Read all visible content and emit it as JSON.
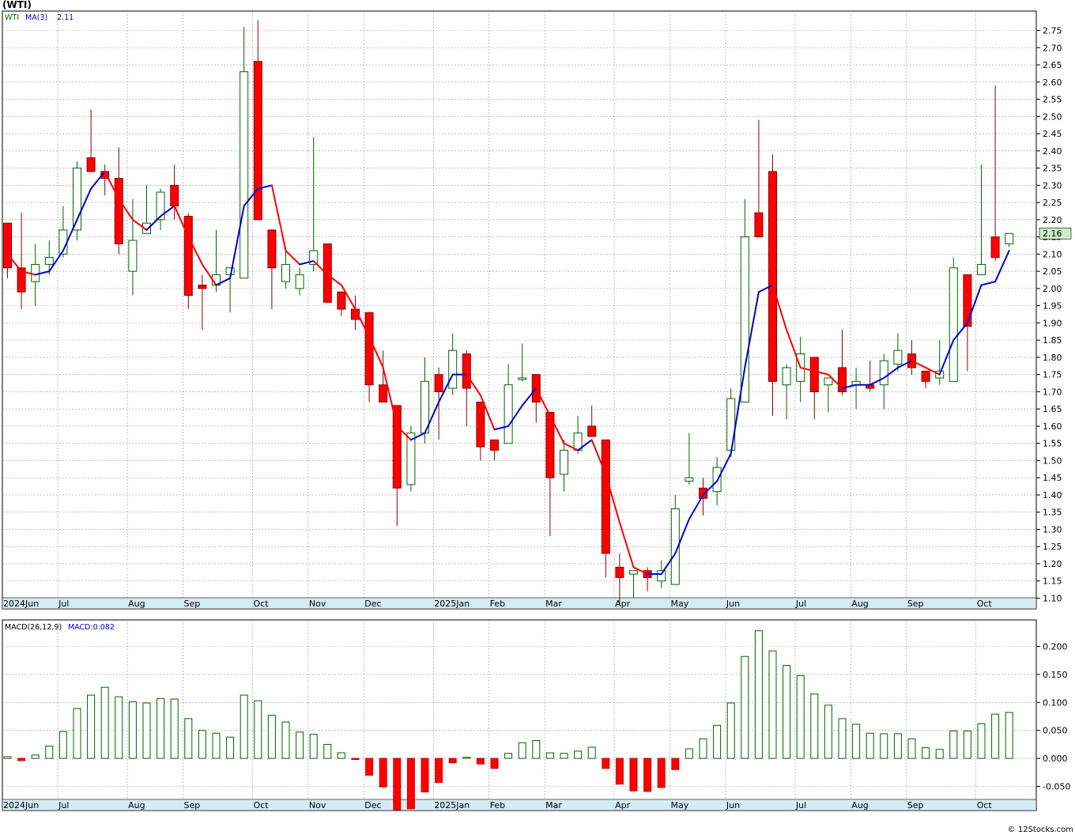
{
  "title": "(WTI)",
  "watermark": "© 12Stocks.com",
  "colors": {
    "up": "#ffffff",
    "upStroke": "#006400",
    "down": "#ff0000",
    "downStroke": "#8b0000",
    "maUp": "#0000cc",
    "maDown": "#ff0000",
    "grid": "#9a9a9a",
    "axisBg": "#d4ecf4",
    "histStroke": "#006400",
    "histDown": "#ff0000",
    "lastBg": "#c8f0c8"
  },
  "chart_data": [
    {
      "type": "candlestick",
      "legend": {
        "symbol": "WTI",
        "ma_label": "MA(3)",
        "ma_value": "2.11"
      },
      "last_price": "2.16",
      "y_ticks": [
        "1.10",
        "1.15",
        "1.20",
        "1.25",
        "1.30",
        "1.35",
        "1.40",
        "1.45",
        "1.50",
        "1.55",
        "1.60",
        "1.65",
        "1.70",
        "1.75",
        "1.80",
        "1.85",
        "1.90",
        "1.95",
        "2.00",
        "2.05",
        "2.10",
        "2.15",
        "2.20",
        "2.25",
        "2.30",
        "2.35",
        "2.40",
        "2.45",
        "2.50",
        "2.55",
        "2.60",
        "2.65",
        "2.70",
        "2.75"
      ],
      "x_labels": [
        {
          "label": "2024Jun",
          "week": 0
        },
        {
          "label": "Jul",
          "week": 4
        },
        {
          "label": "Aug",
          "week": 9
        },
        {
          "label": "Sep",
          "week": 13
        },
        {
          "label": "Oct",
          "week": 18
        },
        {
          "label": "Nov",
          "week": 22
        },
        {
          "label": "Dec",
          "week": 26
        },
        {
          "label": "2025Jan",
          "week": 31
        },
        {
          "label": "Feb",
          "week": 35
        },
        {
          "label": "Mar",
          "week": 39
        },
        {
          "label": "Apr",
          "week": 44
        },
        {
          "label": "May",
          "week": 48
        },
        {
          "label": "Jun",
          "week": 52
        },
        {
          "label": "Jul",
          "week": 57
        },
        {
          "label": "Aug",
          "week": 61
        },
        {
          "label": "Sep",
          "week": 65
        },
        {
          "label": "Oct",
          "week": 70
        }
      ],
      "ohlc": [
        [
          2.19,
          2.19,
          2.03,
          2.06
        ],
        [
          2.06,
          2.22,
          1.94,
          1.99
        ],
        [
          2.02,
          2.13,
          1.95,
          2.07
        ],
        [
          2.07,
          2.14,
          2.04,
          2.09
        ],
        [
          2.1,
          2.24,
          2.09,
          2.17
        ],
        [
          2.17,
          2.37,
          2.14,
          2.35
        ],
        [
          2.38,
          2.52,
          2.34,
          2.34
        ],
        [
          2.34,
          2.36,
          2.27,
          2.32
        ],
        [
          2.32,
          2.41,
          2.1,
          2.13
        ],
        [
          2.05,
          2.26,
          1.98,
          2.14
        ],
        [
          2.16,
          2.3,
          2.16,
          2.19
        ],
        [
          2.2,
          2.29,
          2.17,
          2.28
        ],
        [
          2.3,
          2.36,
          2.2,
          2.24
        ],
        [
          2.21,
          2.22,
          1.94,
          1.98
        ],
        [
          2.01,
          2.04,
          1.88,
          2.0
        ],
        [
          2.01,
          2.17,
          1.99,
          2.04
        ],
        [
          2.04,
          2.05,
          1.93,
          2.06
        ],
        [
          2.03,
          2.76,
          2.03,
          2.63
        ],
        [
          2.66,
          2.78,
          2.2,
          2.2
        ],
        [
          2.17,
          2.17,
          1.94,
          2.06
        ],
        [
          2.02,
          2.12,
          2.0,
          2.07
        ],
        [
          2.0,
          2.06,
          1.98,
          2.04
        ],
        [
          2.07,
          2.44,
          2.05,
          2.11
        ],
        [
          2.13,
          2.13,
          1.96,
          1.96
        ],
        [
          1.99,
          1.99,
          1.92,
          1.94
        ],
        [
          1.94,
          1.98,
          1.88,
          1.91
        ],
        [
          1.93,
          1.93,
          1.67,
          1.72
        ],
        [
          1.72,
          1.82,
          1.67,
          1.67
        ],
        [
          1.66,
          1.66,
          1.31,
          1.42
        ],
        [
          1.43,
          1.6,
          1.41,
          1.58
        ],
        [
          1.58,
          1.8,
          1.55,
          1.73
        ],
        [
          1.75,
          1.77,
          1.56,
          1.7
        ],
        [
          1.71,
          1.87,
          1.69,
          1.82
        ],
        [
          1.81,
          1.82,
          1.6,
          1.71
        ],
        [
          1.67,
          1.67,
          1.5,
          1.54
        ],
        [
          1.56,
          1.55,
          1.5,
          1.53
        ],
        [
          1.55,
          1.78,
          1.55,
          1.72
        ],
        [
          1.74,
          1.84,
          1.73,
          1.74
        ],
        [
          1.75,
          1.75,
          1.61,
          1.67
        ],
        [
          1.64,
          1.64,
          1.28,
          1.45
        ],
        [
          1.46,
          1.56,
          1.41,
          1.53
        ],
        [
          1.53,
          1.63,
          1.52,
          1.58
        ],
        [
          1.6,
          1.66,
          1.57,
          1.57
        ],
        [
          1.56,
          1.56,
          1.16,
          1.23
        ],
        [
          1.19,
          1.23,
          1.08,
          1.16
        ],
        [
          1.17,
          1.18,
          1.1,
          1.18
        ],
        [
          1.18,
          1.19,
          1.12,
          1.16
        ],
        [
          1.15,
          1.21,
          1.13,
          1.18
        ],
        [
          1.14,
          1.4,
          1.14,
          1.36
        ],
        [
          1.44,
          1.58,
          1.43,
          1.45
        ],
        [
          1.42,
          1.45,
          1.34,
          1.39
        ],
        [
          1.41,
          1.51,
          1.37,
          1.48
        ],
        [
          1.53,
          1.71,
          1.51,
          1.68
        ],
        [
          1.67,
          2.26,
          1.67,
          2.15
        ],
        [
          2.22,
          2.49,
          2.15,
          2.15
        ],
        [
          2.34,
          2.39,
          1.63,
          1.73
        ],
        [
          1.72,
          1.78,
          1.62,
          1.77
        ],
        [
          1.73,
          1.86,
          1.67,
          1.81
        ],
        [
          1.8,
          1.8,
          1.62,
          1.7
        ],
        [
          1.72,
          1.74,
          1.64,
          1.74
        ],
        [
          1.77,
          1.88,
          1.69,
          1.7
        ],
        [
          1.72,
          1.77,
          1.65,
          1.73
        ],
        [
          1.72,
          1.79,
          1.7,
          1.71
        ],
        [
          1.72,
          1.81,
          1.65,
          1.79
        ],
        [
          1.78,
          1.87,
          1.76,
          1.82
        ],
        [
          1.81,
          1.85,
          1.75,
          1.77
        ],
        [
          1.76,
          1.76,
          1.71,
          1.73
        ],
        [
          1.74,
          1.85,
          1.72,
          1.76
        ],
        [
          1.73,
          2.09,
          1.73,
          2.06
        ],
        [
          2.04,
          2.04,
          1.76,
          1.89
        ],
        [
          2.04,
          2.36,
          2.04,
          2.07
        ],
        [
          2.15,
          2.59,
          2.08,
          2.09
        ],
        [
          2.13,
          2.16,
          2.12,
          2.16
        ]
      ],
      "ma3": [
        2.1,
        2.05,
        2.04,
        2.05,
        2.11,
        2.2,
        2.29,
        2.34,
        2.26,
        2.2,
        2.17,
        2.21,
        2.24,
        2.15,
        2.07,
        2.01,
        2.03,
        2.24,
        2.29,
        2.3,
        2.11,
        2.07,
        2.08,
        2.04,
        2.01,
        1.94,
        1.86,
        1.77,
        1.6,
        1.56,
        1.58,
        1.67,
        1.75,
        1.75,
        1.69,
        1.59,
        1.6,
        1.66,
        1.71,
        1.63,
        1.55,
        1.53,
        1.56,
        1.46,
        1.32,
        1.19,
        1.17,
        1.17,
        1.23,
        1.33,
        1.4,
        1.44,
        1.52,
        1.77,
        1.99,
        2.01,
        1.88,
        1.77,
        1.76,
        1.75,
        1.71,
        1.72,
        1.72,
        1.74,
        1.77,
        1.79,
        1.77,
        1.75,
        1.85,
        1.9,
        2.01,
        2.02,
        2.11
      ]
    },
    {
      "type": "bar",
      "legend": {
        "name": "MACD(26,12,9)",
        "value_label": "MACD:0.082"
      },
      "y_ticks": [
        "-0.050",
        "0.000",
        "0.050",
        "0.100",
        "0.150",
        "0.200"
      ],
      "values": [
        0.003,
        -0.004,
        0.006,
        0.022,
        0.048,
        0.089,
        0.113,
        0.127,
        0.11,
        0.101,
        0.099,
        0.107,
        0.106,
        0.071,
        0.05,
        0.045,
        0.038,
        0.113,
        0.103,
        0.077,
        0.065,
        0.047,
        0.043,
        0.025,
        0.01,
        -0.002,
        -0.03,
        -0.051,
        -0.092,
        -0.09,
        -0.06,
        -0.043,
        -0.008,
        0.002,
        -0.01,
        -0.018,
        0.009,
        0.028,
        0.032,
        0.01,
        0.009,
        0.013,
        0.02,
        -0.018,
        -0.046,
        -0.058,
        -0.059,
        -0.052,
        -0.02,
        0.017,
        0.035,
        0.059,
        0.099,
        0.182,
        0.228,
        0.192,
        0.166,
        0.148,
        0.115,
        0.095,
        0.071,
        0.061,
        0.045,
        0.044,
        0.044,
        0.035,
        0.019,
        0.016,
        0.049,
        0.049,
        0.062,
        0.079,
        0.082
      ]
    }
  ]
}
